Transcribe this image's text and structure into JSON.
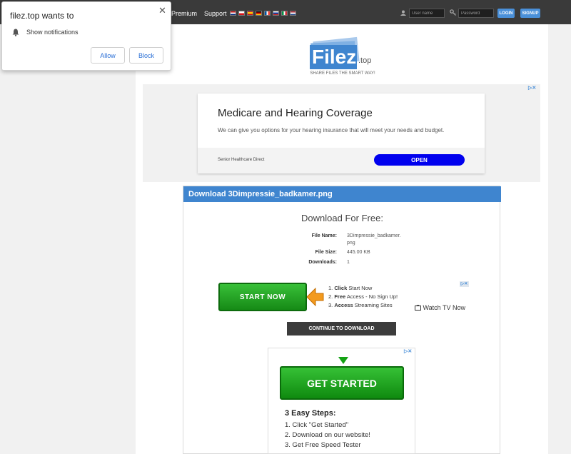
{
  "nav": {
    "premium": "Premium",
    "support": "Support"
  },
  "login": {
    "username_placeholder": "User name",
    "password_placeholder": "Password",
    "login_label": "LOGIN",
    "signup_label": "SIGNUP"
  },
  "logo": {
    "brand": "Filez",
    "tld": ".top",
    "tagline": "SHARE FILES THE SMART WAY!"
  },
  "ad1": {
    "title": "Medicare and Hearing Coverage",
    "description": "We can give you options for your hearing insurance that will meet your needs and budget.",
    "sponsor": "Senior Healthcare Direct",
    "cta": "OPEN",
    "choice": "▷✕"
  },
  "download": {
    "header": "Download 3Dimpressie_badkamer.png",
    "title": "Download For Free:",
    "file_name_label": "File Name:",
    "file_name_line1": "3Dimpressie_badkamer.",
    "file_name_line2": "png",
    "file_size_label": "File Size:",
    "file_size": "445.00 KB",
    "downloads_label": "Downloads:",
    "downloads": "1"
  },
  "ad2": {
    "button": "START NOW",
    "step1_bold": "Click",
    "step1_rest": " Start Now",
    "step2_bold": "Free",
    "step2_rest": " Access - No Sign Up!",
    "step3_bold": "Access",
    "step3_rest": " Streaming Sites",
    "watch": "Watch TV Now",
    "choice": "▷✕"
  },
  "continue": "CONTINUE TO DOWNLOAD",
  "ad3": {
    "button": "GET STARTED",
    "heading": "3 Easy Steps:",
    "step1": "1. Click \"Get Started\"",
    "step2": "2. Download on our website!",
    "step3": "3. Get Free Speed Tester",
    "choice": "▷✕"
  },
  "notification": {
    "title": "filez.top wants to",
    "close": "✕",
    "text": "Show notifications",
    "allow": "Allow",
    "block": "Block"
  },
  "colors": {
    "accent": "#3f85cf",
    "topbar": "#3a3a3a",
    "green": "#168a16",
    "open_blue": "#0000ee"
  }
}
